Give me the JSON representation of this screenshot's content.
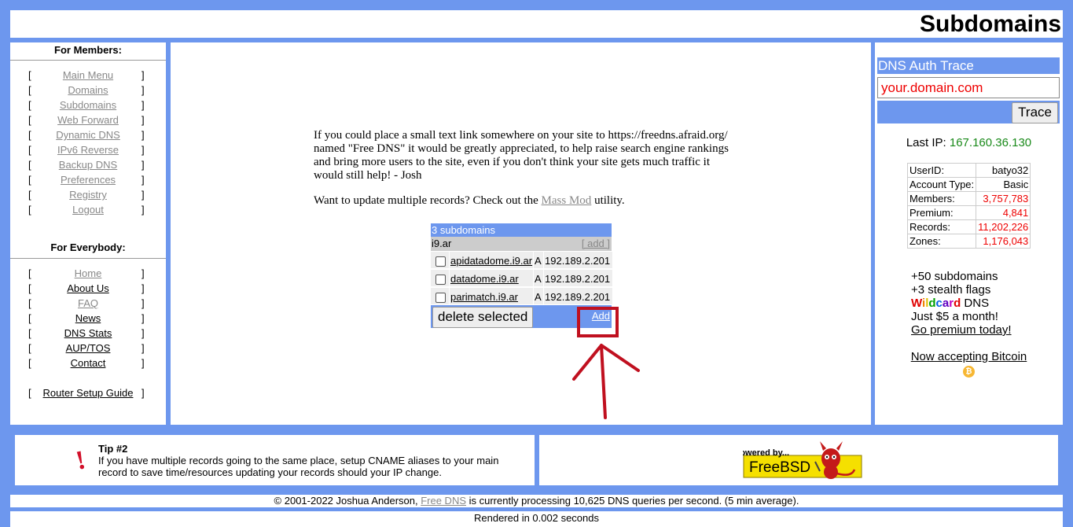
{
  "header": {
    "title": "Subdomains"
  },
  "members_nav": {
    "heading": "For Members:",
    "items": [
      {
        "label": "Main Menu"
      },
      {
        "label": "Domains"
      },
      {
        "label": "Subdomains"
      },
      {
        "label": "Web Forward"
      },
      {
        "label": "Dynamic DNS"
      },
      {
        "label": "IPv6 Reverse"
      },
      {
        "label": "Backup DNS"
      },
      {
        "label": "Preferences"
      },
      {
        "label": "Registry"
      },
      {
        "label": "Logout"
      }
    ]
  },
  "everybody_nav": {
    "heading": "For Everybody:",
    "items": [
      {
        "label": "Home"
      },
      {
        "label": "About Us"
      },
      {
        "label": "FAQ"
      },
      {
        "label": "News"
      },
      {
        "label": "DNS Stats"
      },
      {
        "label": "AUP/TOS"
      },
      {
        "label": "Contact"
      }
    ],
    "router_guide": "Router Setup Guide"
  },
  "brackets": {
    "left": "[",
    "right": "]"
  },
  "intro": {
    "text1": "If you could place a small text link somewhere on your site to https://freedns.afraid.org/ named \"Free DNS\" it would be greatly appreciated, to help raise search engine rankings and bring more users to the site, even if you don't think your site gets much traffic it would still help! - Josh",
    "text2_before": "Want to update multiple records? Check out the ",
    "text2_link": "Mass Mod",
    "text2_after": " utility."
  },
  "subdomains": {
    "header": "3 subdomains",
    "zone": "i9.ar",
    "zone_add": "[ add ]",
    "records": [
      {
        "name": "apidatadome.i9.ar",
        "type": "A",
        "value": "192.189.2.201"
      },
      {
        "name": "datadome.i9.ar",
        "type": "A",
        "value": "192.189.2.201"
      },
      {
        "name": "parimatch.i9.ar",
        "type": "A",
        "value": "192.189.2.201"
      }
    ],
    "delete_button": "delete selected",
    "add_link": "Add"
  },
  "trace": {
    "header": "DNS Auth Trace",
    "input_value": "your.domain.com",
    "button": "Trace"
  },
  "last_ip": {
    "label": "Last IP:",
    "value": "167.160.36.130"
  },
  "stats": {
    "rows": [
      {
        "label": "UserID:",
        "value": "batyo32"
      },
      {
        "label": "Account Type:",
        "value": "Basic"
      },
      {
        "label": "Members:",
        "value": "3,757,783"
      },
      {
        "label": "Premium:",
        "value": "4,841"
      },
      {
        "label": "Records:",
        "value": "11,202,226"
      },
      {
        "label": "Zones:",
        "value": "1,176,043"
      }
    ]
  },
  "promo": {
    "line1": "+50 subdomains",
    "line2": "+3 stealth flags",
    "wildcard": "Wildcard",
    "dns": " DNS",
    "line4": "Just $5 a month!",
    "link": "Go premium today!"
  },
  "bitcoin": {
    "link": "Now accepting Bitcoin",
    "coin": "₿"
  },
  "tip": {
    "title": "Tip #2",
    "text": "If you have multiple records going to the same place, setup CNAME aliases to your main record to save time/resources updating your records should your IP change."
  },
  "powered": {
    "top": "Powered by...",
    "brand": "FreeBSD"
  },
  "footer": {
    "copyright_before": "© 2001-2022 Joshua Anderson, ",
    "copyright_link": "Free DNS",
    "copyright_after": " is currently processing 10,625 DNS queries per second. (5 min average).",
    "rendered": "Rendered in 0.002 seconds"
  },
  "colors": {
    "accent": "#6d97ee",
    "highlight": "#c0101f",
    "ip_green": "#1a8a1a",
    "value_red": "#e00000"
  }
}
